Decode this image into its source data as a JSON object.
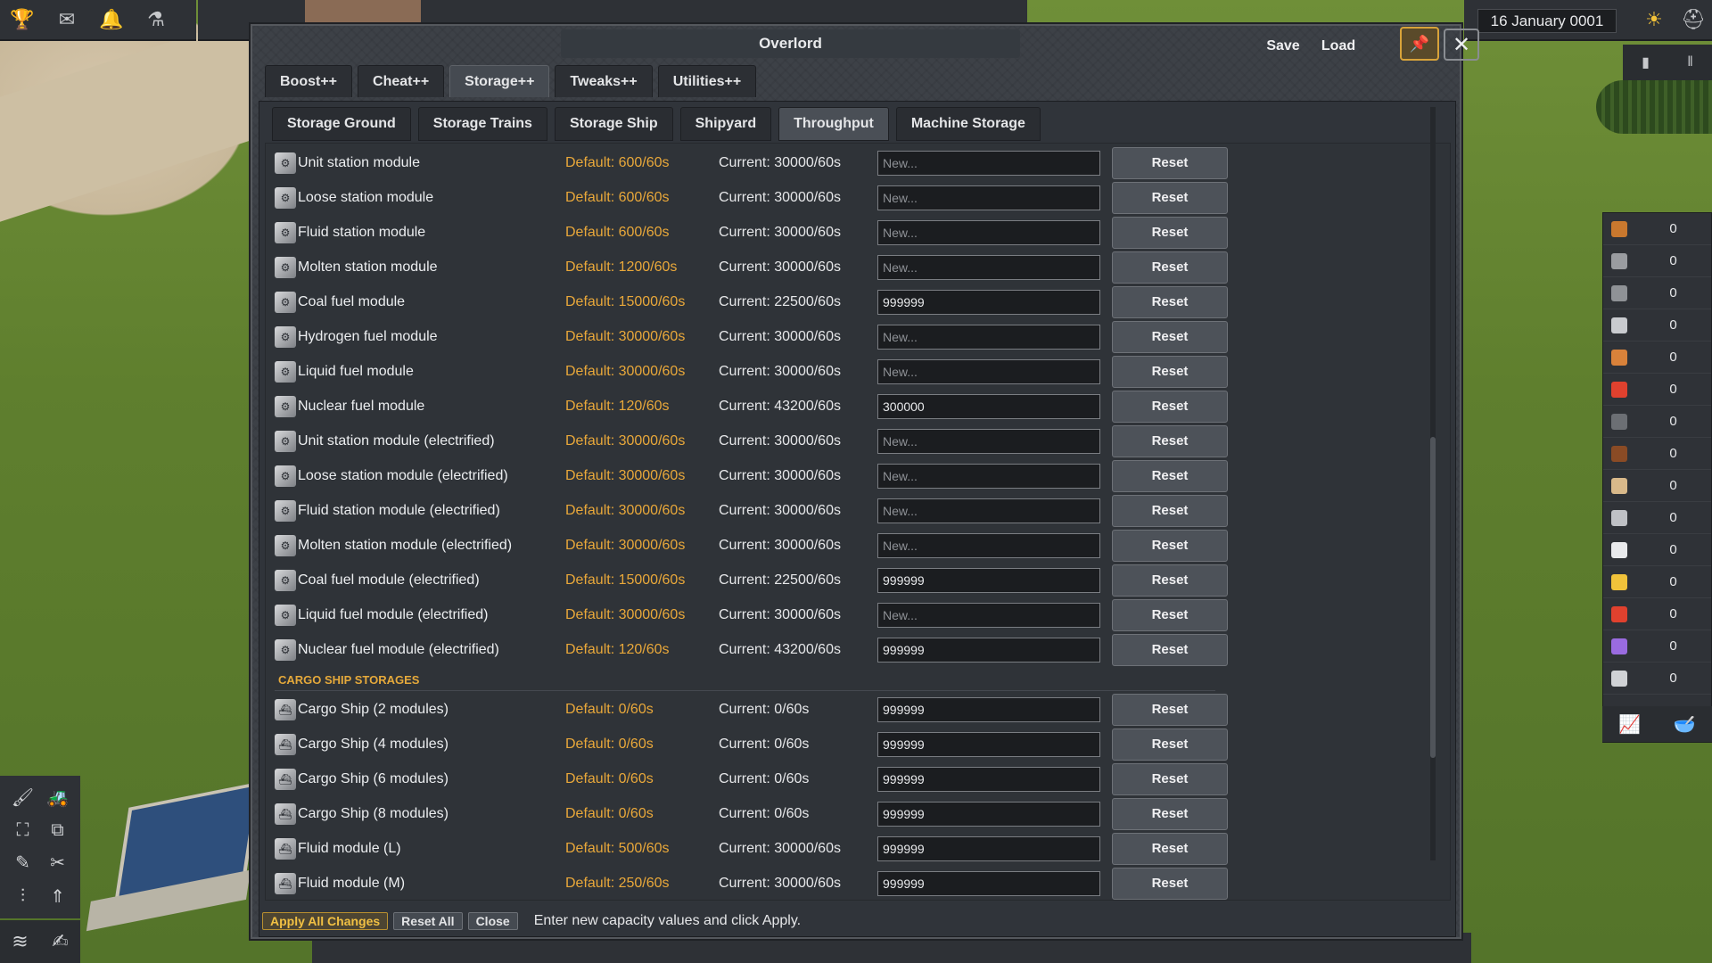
{
  "hud": {
    "date": "16 January 0001",
    "left_icons": [
      "trophy-icon",
      "mail-icon",
      "bell-icon",
      "flask-icon"
    ],
    "right_icons": [
      "sun-icon",
      "hat-icon"
    ]
  },
  "modal": {
    "title": "Overlord",
    "save_label": "Save",
    "load_label": "Load",
    "tabs": [
      {
        "label": "Boost++"
      },
      {
        "label": "Cheat++"
      },
      {
        "label": "Storage++",
        "active": true
      },
      {
        "label": "Tweaks++"
      },
      {
        "label": "Utilities++"
      }
    ],
    "subtabs": [
      {
        "label": "Storage Ground"
      },
      {
        "label": "Storage Trains"
      },
      {
        "label": "Storage Ship"
      },
      {
        "label": "Shipyard"
      },
      {
        "label": "Throughput",
        "active": true
      },
      {
        "label": "Machine Storage"
      }
    ],
    "reset_label": "Reset",
    "placeholder": "New...",
    "rows": [
      {
        "name": "Unit station module",
        "default": "Default: 600/60s",
        "current": "Current: 30000/60s",
        "value": ""
      },
      {
        "name": "Loose station module",
        "default": "Default: 600/60s",
        "current": "Current: 30000/60s",
        "value": ""
      },
      {
        "name": "Fluid station module",
        "default": "Default: 600/60s",
        "current": "Current: 30000/60s",
        "value": ""
      },
      {
        "name": "Molten station module",
        "default": "Default: 1200/60s",
        "current": "Current: 30000/60s",
        "value": ""
      },
      {
        "name": "Coal fuel module",
        "default": "Default: 15000/60s",
        "current": "Current: 22500/60s",
        "value": "999999"
      },
      {
        "name": "Hydrogen fuel module",
        "default": "Default: 30000/60s",
        "current": "Current: 30000/60s",
        "value": ""
      },
      {
        "name": "Liquid fuel module",
        "default": "Default: 30000/60s",
        "current": "Current: 30000/60s",
        "value": ""
      },
      {
        "name": "Nuclear fuel module",
        "default": "Default: 120/60s",
        "current": "Current: 43200/60s",
        "value": "300000"
      },
      {
        "name": "Unit station module (electrified)",
        "default": "Default: 30000/60s",
        "current": "Current: 30000/60s",
        "value": ""
      },
      {
        "name": "Loose station module (electrified)",
        "default": "Default: 30000/60s",
        "current": "Current: 30000/60s",
        "value": ""
      },
      {
        "name": "Fluid station module (electrified)",
        "default": "Default: 30000/60s",
        "current": "Current: 30000/60s",
        "value": ""
      },
      {
        "name": "Molten station module (electrified)",
        "default": "Default: 30000/60s",
        "current": "Current: 30000/60s",
        "value": ""
      },
      {
        "name": "Coal fuel module (electrified)",
        "default": "Default: 15000/60s",
        "current": "Current: 22500/60s",
        "value": "999999"
      },
      {
        "name": "Liquid fuel module (electrified)",
        "default": "Default: 30000/60s",
        "current": "Current: 30000/60s",
        "value": ""
      },
      {
        "name": "Nuclear fuel module (electrified)",
        "default": "Default: 120/60s",
        "current": "Current: 43200/60s",
        "value": "999999"
      }
    ],
    "section_title": "CARGO SHIP STORAGES",
    "ship_rows": [
      {
        "name": "Cargo Ship (2 modules)",
        "default": "Default: 0/60s",
        "current": "Current: 0/60s",
        "value": "999999"
      },
      {
        "name": "Cargo Ship (4 modules)",
        "default": "Default: 0/60s",
        "current": "Current: 0/60s",
        "value": "999999"
      },
      {
        "name": "Cargo Ship (6 modules)",
        "default": "Default: 0/60s",
        "current": "Current: 0/60s",
        "value": "999999"
      },
      {
        "name": "Cargo Ship (8 modules)",
        "default": "Default: 0/60s",
        "current": "Current: 0/60s",
        "value": "999999"
      },
      {
        "name": "Fluid module (L)",
        "default": "Default: 500/60s",
        "current": "Current: 30000/60s",
        "value": "999999"
      },
      {
        "name": "Fluid module (M)",
        "default": "Default: 250/60s",
        "current": "Current: 30000/60s",
        "value": "999999"
      }
    ],
    "footer": {
      "apply": "Apply All Changes",
      "reset_all": "Reset All",
      "close": "Close",
      "hint": "Enter new capacity values and click Apply."
    }
  },
  "resources": [
    {
      "icon": "wood-icon",
      "color": "#c9782e",
      "value": "0"
    },
    {
      "icon": "rock-icon",
      "color": "#9a9ca0",
      "value": "0"
    },
    {
      "icon": "plate-icon",
      "color": "#8f9296",
      "value": "0"
    },
    {
      "icon": "steel-icon",
      "color": "#c9cbcf",
      "value": "0"
    },
    {
      "icon": "copper-icon",
      "color": "#d9823a",
      "value": "0"
    },
    {
      "icon": "fuel-icon",
      "color": "#e0412e",
      "value": "0"
    },
    {
      "icon": "bars-icon",
      "color": "#6c6f74",
      "value": "0"
    },
    {
      "icon": "beans-icon",
      "color": "#8a4b25",
      "value": "0"
    },
    {
      "icon": "box-icon",
      "color": "#d9b98a",
      "value": "0"
    },
    {
      "icon": "crate-icon",
      "color": "#bfc1c5",
      "value": "0"
    },
    {
      "icon": "worker-white-icon",
      "color": "#e9eaec",
      "value": "0"
    },
    {
      "icon": "worker-yellow-icon",
      "color": "#f0c23a",
      "value": "0"
    },
    {
      "icon": "worker-red-icon",
      "color": "#e0412e",
      "value": "0"
    },
    {
      "icon": "worker-purple-icon",
      "color": "#9a6be0",
      "value": "0"
    },
    {
      "icon": "wrench-icon",
      "color": "#d0d2d5",
      "value": "0"
    }
  ]
}
